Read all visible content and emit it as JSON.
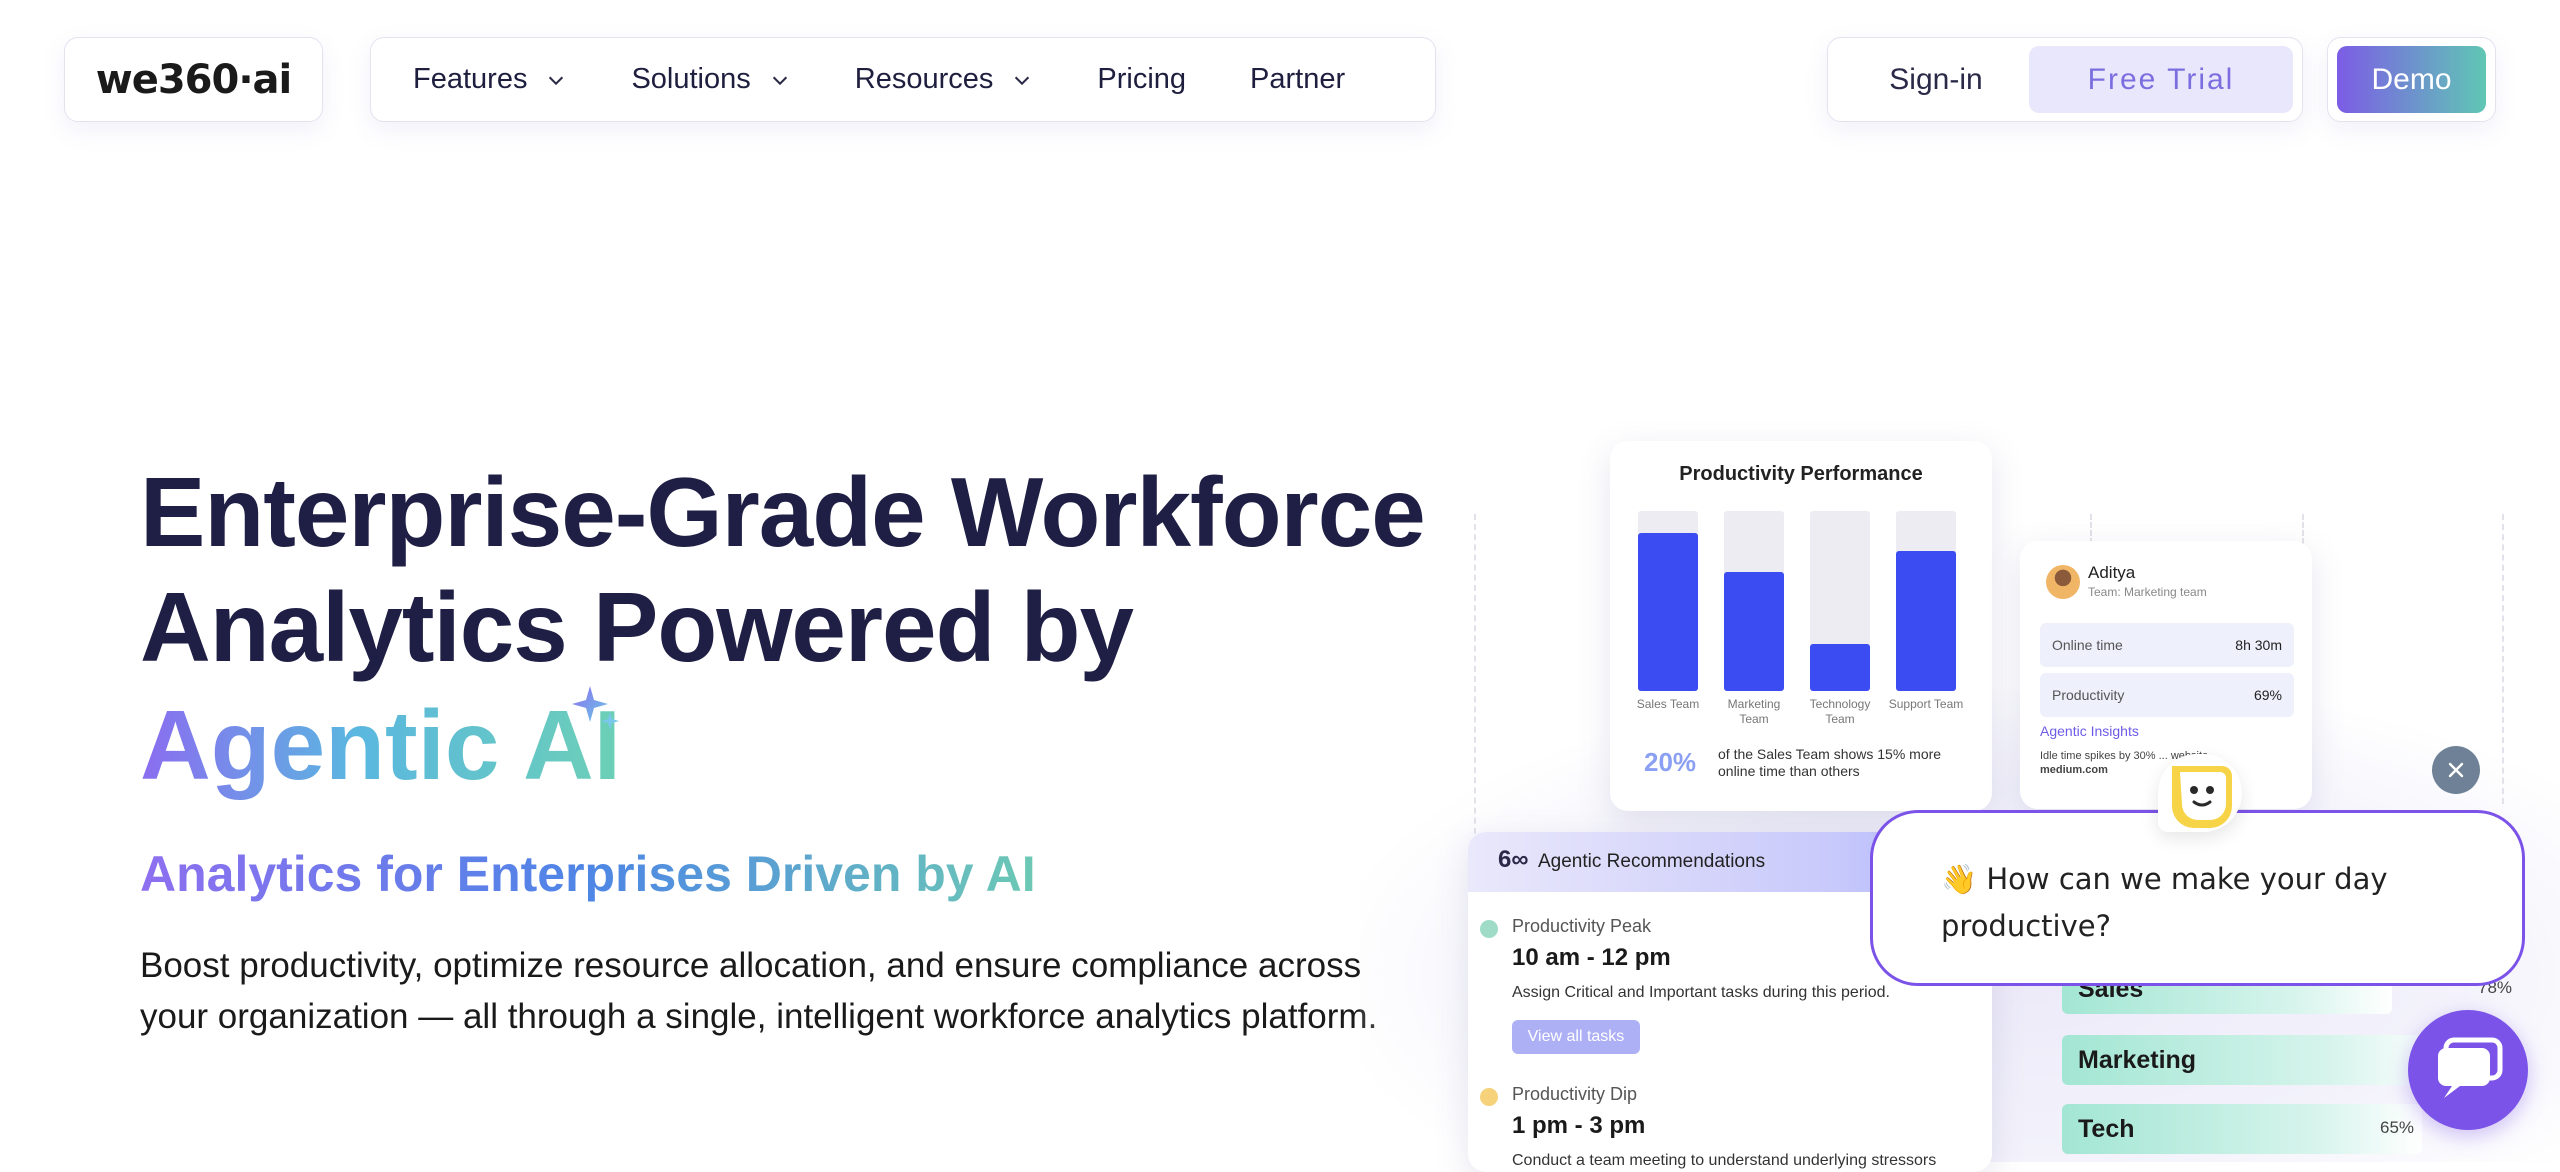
{
  "nav": {
    "logo": "we360·ai",
    "items": [
      {
        "label": "Features",
        "has_dropdown": true
      },
      {
        "label": "Solutions",
        "has_dropdown": true
      },
      {
        "label": "Resources",
        "has_dropdown": true
      },
      {
        "label": "Pricing",
        "has_dropdown": false
      },
      {
        "label": "Partner",
        "has_dropdown": false
      }
    ],
    "signin": "Sign-in",
    "free_trial": "Free Trial",
    "demo": "Demo"
  },
  "hero": {
    "title_line1": "Enterprise-Grade Workforce",
    "title_line2": "Analytics Powered by",
    "title_accent": "Agentic AI",
    "subtitle": "Analytics for Enterprises Driven by AI",
    "body": "Boost productivity, optimize resource allocation, and ensure compliance across your organization — all through a single, intelligent workforce analytics platform."
  },
  "productivity_card": {
    "title": "Productivity Performance",
    "chart_data": {
      "type": "bar",
      "categories": [
        "Sales Team",
        "Marketing Team",
        "Technology Team",
        "Support Team"
      ],
      "values": [
        88,
        66,
        26,
        78
      ],
      "ylim": [
        0,
        100
      ],
      "title": "Productivity Performance"
    },
    "highlight_pct": "20%",
    "highlight_note": "of the Sales Team shows 15% more online time than others"
  },
  "employee_card": {
    "name": "Aditya",
    "team": "Team:  Marketing team",
    "rows": [
      {
        "label": "Online time",
        "value": "8h 30m"
      },
      {
        "label": "Productivity",
        "value": "69%"
      }
    ],
    "insights_title": "Agentic Insights",
    "insights_text": "Idle time spikes by 30% ... website",
    "insights_site": "medium.com"
  },
  "recommendations_card": {
    "title": "Agentic Recommendations",
    "logo": "6∞",
    "items": [
      {
        "kind": "Productivity Peak",
        "time": "10 am - 12 pm",
        "desc": "Assign Critical and Important tasks during this period.",
        "button": "View all tasks",
        "dot_color": "#9fdcc8"
      },
      {
        "kind": "Productivity Dip",
        "time": "1 pm - 3 pm",
        "desc": "Conduct a team meeting to understand underlying stressors",
        "dot_color": "#f6d27a"
      }
    ]
  },
  "team_bars": [
    {
      "label": "Sales",
      "pct": "78%"
    },
    {
      "label": "Marketing",
      "pct": ""
    },
    {
      "label": "Tech",
      "pct": "65%"
    }
  ],
  "chat": {
    "greeting_emoji": "👋",
    "greeting": "How can we make your day productive?",
    "accent": "#7b53e8"
  },
  "colors": {
    "bar_blue": "#3b4cf2",
    "accent_purple": "#7c5ce6",
    "accent_teal": "#5fc7b4"
  }
}
